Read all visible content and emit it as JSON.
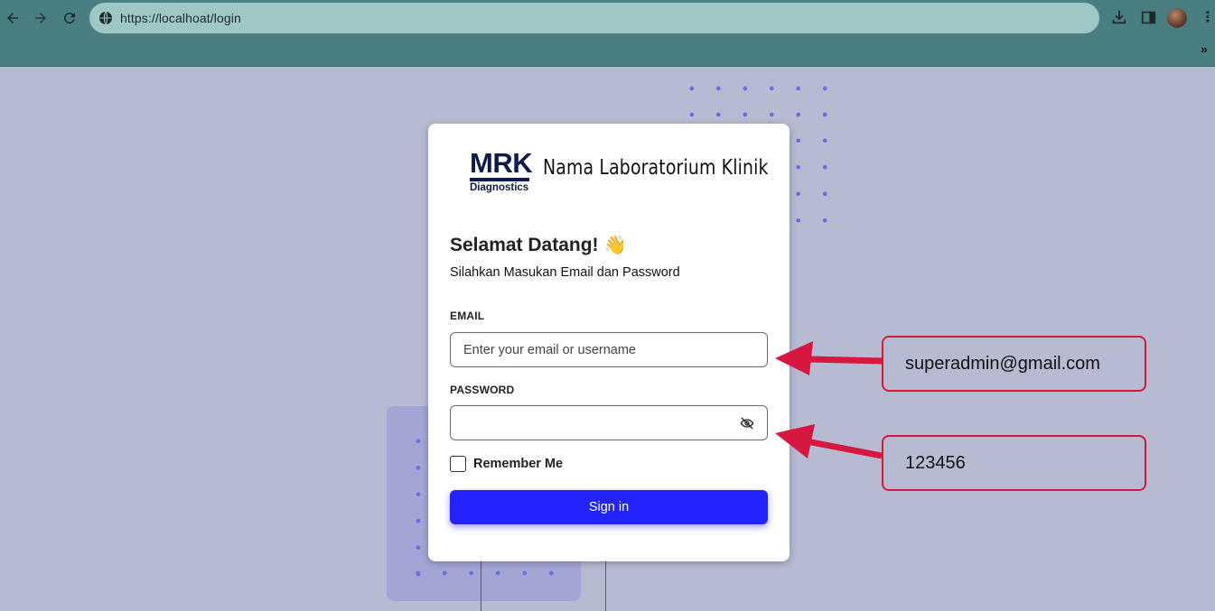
{
  "browser": {
    "url": "https://localhoat/login",
    "extensions_chevron": "»"
  },
  "card": {
    "logo_text": "MRK",
    "logo_subtext": "Diagnostics",
    "lab_name": "Nama Laboratorium Klinik",
    "welcome": "Selamat Datang!",
    "welcome_emoji": "👋",
    "subtitle": "Silahkan Masukan Email dan Password",
    "email_label": "EMAIL",
    "email_placeholder": "Enter your email or username",
    "password_label": "PASSWORD",
    "remember_label": "Remember Me",
    "signin_label": "Sign in"
  },
  "annotations": {
    "email_value": "superadmin@gmail.com",
    "password_value": "123456",
    "color": "#d6173f"
  },
  "colors": {
    "chrome": "#4a7f82",
    "background": "#b7bbd2",
    "primary_button": "#2323ff",
    "dots": "#6b6ee6"
  }
}
